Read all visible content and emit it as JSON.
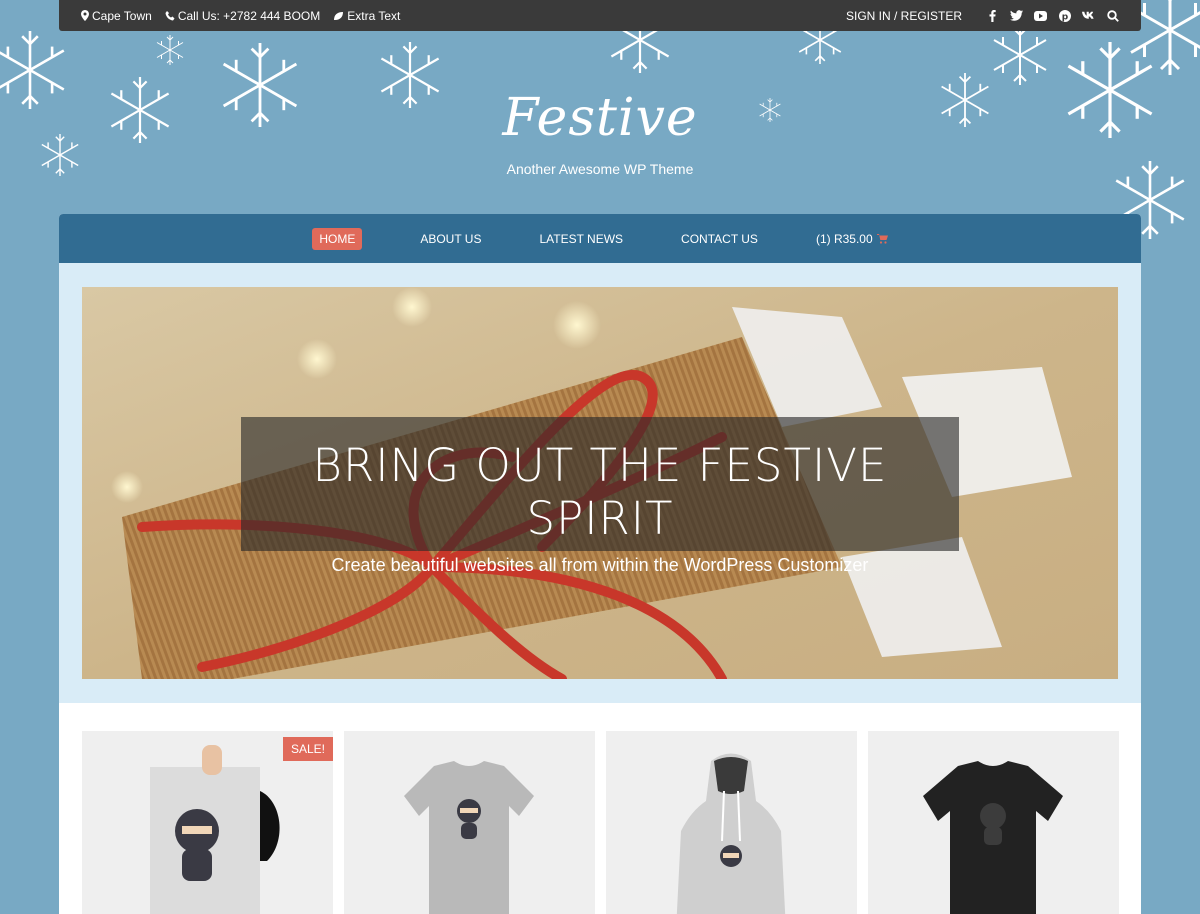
{
  "topbar": {
    "location": "Cape Town",
    "phone": "Call Us: +2782 444 BOOM",
    "extra": "Extra Text",
    "signin": "SIGN IN / REGISTER",
    "social_icons": [
      "facebook-icon",
      "twitter-icon",
      "youtube-icon",
      "pinterest-icon",
      "vk-icon",
      "search-icon"
    ]
  },
  "site": {
    "title": "Festive",
    "tagline": "Another Awesome WP Theme"
  },
  "nav": {
    "items": [
      "HOME",
      "ABOUT US",
      "LATEST NEWS",
      "CONTACT US"
    ],
    "cart": "(1) R35.00"
  },
  "hero": {
    "heading": "BRING OUT THE FESTIVE SPIRIT",
    "subheading": "Create beautiful websites all from within the WordPress Customizer"
  },
  "products": {
    "sale_badge": "SALE!"
  },
  "colors": {
    "background": "#78a9c4",
    "nav": "#316c92",
    "accent": "#e06a5a",
    "topbar": "#3a3a3a"
  }
}
